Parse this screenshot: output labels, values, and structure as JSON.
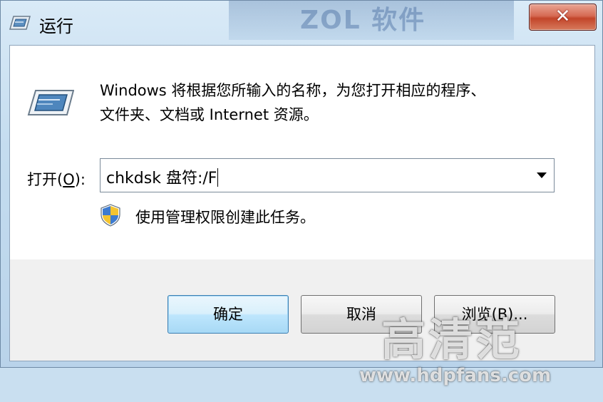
{
  "window": {
    "title": "运行",
    "close_label": "✕",
    "background_text": "ZOL 软件"
  },
  "dialog": {
    "description_line1": "Windows 将根据您所输入的名称，为您打开相应的程序、",
    "description_line2": "文件夹、文档或 Internet 资源。",
    "open_label_prefix": "打开(",
    "open_label_key": "O",
    "open_label_suffix": "):",
    "open_value": "chkdsk 盘符:/F",
    "admin_note": "使用管理权限创建此任务。"
  },
  "buttons": {
    "ok_label": "确定",
    "cancel_label": "取消",
    "browse_label": "浏览(B)..."
  },
  "watermark": {
    "big_text": "高清范",
    "url": "www.hdpfans.com"
  },
  "icons": {
    "title": "run-icon",
    "main": "run-icon",
    "admin": "uac-shield-icon",
    "dropdown": "chevron-down-icon",
    "close": "close-icon"
  },
  "colors": {
    "close_button": "#c2452a",
    "ok_border": "#3c7fb1",
    "frame": "#c4dcef"
  }
}
